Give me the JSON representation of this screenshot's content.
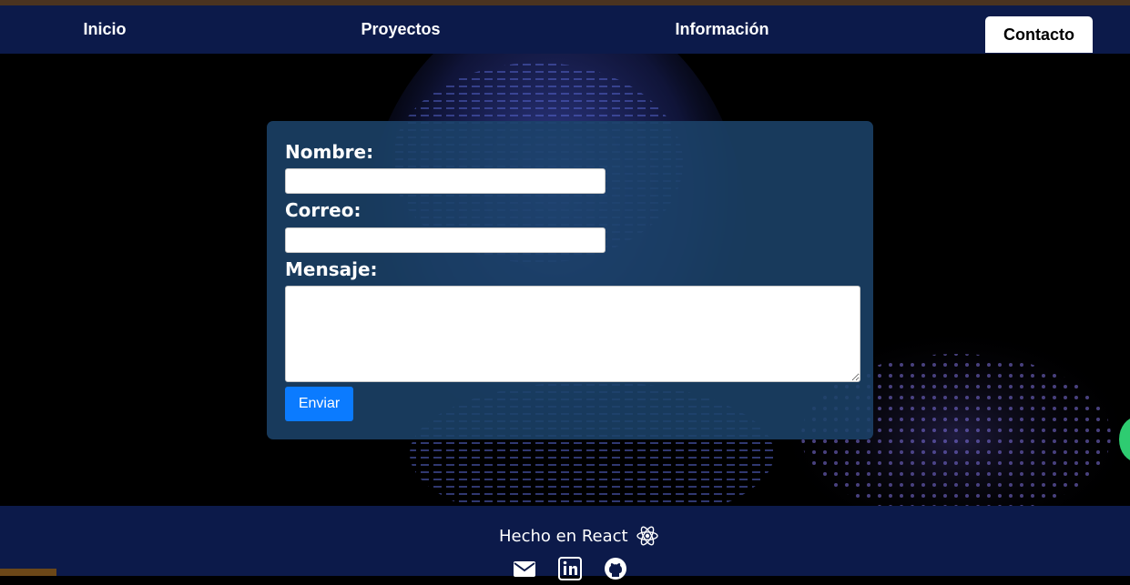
{
  "nav": {
    "items": [
      {
        "label": "Inicio",
        "active": false
      },
      {
        "label": "Proyectos",
        "active": false
      },
      {
        "label": "Información",
        "active": false
      },
      {
        "label": "Contacto",
        "active": true
      }
    ]
  },
  "form": {
    "name_label": "Nombre:",
    "name_value": "",
    "email_label": "Correo:",
    "email_value": "",
    "message_label": "Mensaje:",
    "message_value": "",
    "submit_label": "Enviar"
  },
  "footer": {
    "made_with": "Hecho en React",
    "react_icon": "react-atom-icon",
    "icons": [
      "envelope-icon",
      "linkedin-icon",
      "github-icon"
    ]
  },
  "colors": {
    "navbar": "#0c1a4a",
    "top_strip": "#4a3320",
    "card": "#1b4269",
    "button": "#0b7bff",
    "footer": "#0c1a4a"
  }
}
